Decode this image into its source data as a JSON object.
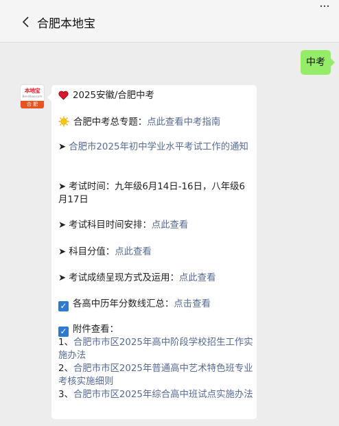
{
  "header": {
    "title": "合肥本地宝",
    "back_icon": "chevron-left-icon",
    "more_icon": "more-dots-icon"
  },
  "sent_message": {
    "text": "中考"
  },
  "avatar": {
    "logo_text": "本地宝",
    "logo_sub": "Bendibao.com",
    "city": "合 肥"
  },
  "reply": {
    "title_emoji": "heart-icon",
    "title": "2025安徽/合肥中考",
    "topic": {
      "emoji": "sun-icon",
      "label": "合肥中考总专题：",
      "link": "点此查看中考指南"
    },
    "arrow": "➤",
    "notice_link": "合肥市2025年初中学业水平考试工作的通知",
    "exam_time": "考试时间：九年级6月14日-16日，八年级6月17日",
    "schedule": {
      "label": "考试科目时间安排：",
      "link": "点此查看"
    },
    "scores": {
      "label": "科目分值：",
      "link": "点此查看"
    },
    "results": {
      "label": "考试成绩呈现方式及运用：",
      "link": "点此查看"
    },
    "cutoff": {
      "check": "✓",
      "label": "各高中历年分数线汇总：",
      "link": "点击查看"
    },
    "attachments": {
      "check": "✓",
      "label": "附件查看：",
      "items": [
        {
          "index": "1、",
          "link": "合肥市市区2025年高中阶段学校招生工作实施办法"
        },
        {
          "index": "2、",
          "link": "合肥市市区2025年普通高中艺术特色班专业考核实施细则"
        },
        {
          "index": "3、",
          "link": "合肥市市区2025年综合高中班试点实施办法"
        }
      ]
    }
  },
  "colors": {
    "background": "#ededed",
    "sent_bubble": "#95ec69",
    "link": "#576b95",
    "brand": "#e8541e"
  }
}
